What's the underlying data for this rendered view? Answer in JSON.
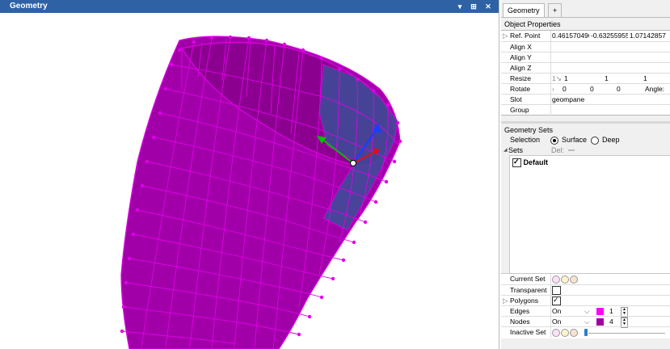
{
  "viewport": {
    "title": "Geometry",
    "controls": [
      "▾",
      "⊞",
      "✕"
    ]
  },
  "panel": {
    "tabs": [
      {
        "label": "Geometry"
      },
      {
        "label": "+"
      }
    ],
    "object_properties": {
      "header": "Object Properties",
      "ref_point": {
        "label": "Ref. Point",
        "x": "0.461570496",
        "y": "-0.63255955",
        "z": "1.07142857"
      },
      "align_x": {
        "label": "Align X"
      },
      "align_y": {
        "label": "Align Y"
      },
      "align_z": {
        "label": "Align Z"
      },
      "resize": {
        "label": "Resize",
        "prefix": "1↘",
        "x": "1",
        "y": "1",
        "z": "1"
      },
      "rotate": {
        "label": "Rotate",
        "prefix": "›",
        "x": "0",
        "y": "0",
        "z": "0",
        "angle_label": "Angle:"
      },
      "slot": {
        "label": "Slot",
        "value": "geompane"
      },
      "group": {
        "label": "Group"
      }
    },
    "geometry_sets": {
      "header": "Geometry Sets",
      "selection_label": "Selection",
      "surface_label": "Surface",
      "deep_label": "Deep",
      "sets_label": "Sets",
      "del_label": "Del:",
      "default_label": "Default"
    },
    "set_props": {
      "current_set": "Current Set",
      "transparent": "Transparent",
      "polygons": "Polygons",
      "edges": {
        "label": "Edges",
        "mode": "On",
        "color": "#ff00ff",
        "value": "1"
      },
      "nodes": {
        "label": "Nodes",
        "mode": "On",
        "color": "#a000a0",
        "value": "4"
      },
      "inactive_set": "Inactive Set"
    }
  }
}
